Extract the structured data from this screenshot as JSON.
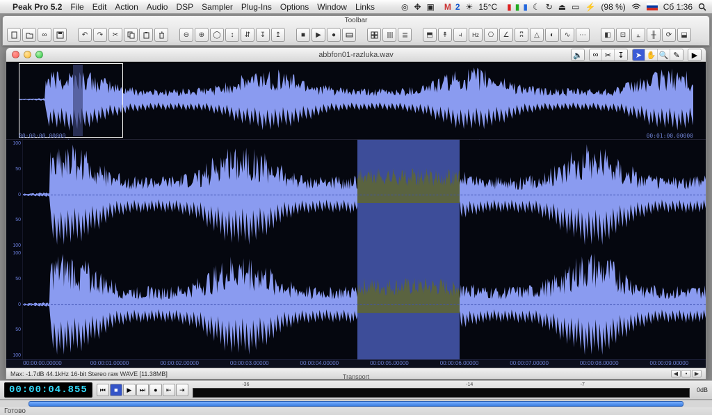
{
  "menubar": {
    "app": "Peak Pro 5.2",
    "items": [
      "File",
      "Edit",
      "Action",
      "Audio",
      "DSP",
      "Sampler",
      "Plug-Ins",
      "Options",
      "Window",
      "Links"
    ],
    "right": {
      "mail_label": "M",
      "mail_count": "2",
      "temp": "15°C",
      "battery": "(98 %)",
      "flag": "ru",
      "clock": "Сб 1:36"
    }
  },
  "toolbar": {
    "title": "Toolbar"
  },
  "document": {
    "title": "abbfon01-razluka.wav",
    "overview": {
      "start_tc": "00:00:00.00000",
      "end_tc": "00:01:00.00000"
    },
    "gutter": {
      "labels": [
        "100",
        "50",
        "0",
        "50",
        "100"
      ]
    },
    "ruler": {
      "marks": [
        "00:00:00.00000",
        "00:00:01.00000",
        "00:00:02.00000",
        "00:00:03.00000",
        "00:00:04.00000",
        "00:00:05.00000",
        "00:00:06.00000",
        "00:00:07.00000",
        "00:00:08.00000",
        "00:00:09.00000"
      ]
    },
    "status": "Max: -1.7dB   44.1kHz 16-bit Stereo raw  WAVE [11.38MB]"
  },
  "transport": {
    "title": "Transport",
    "timecode": "00:00:04.855",
    "vu_marks": [
      "-36",
      "-14",
      "-7"
    ],
    "readout": "0dB"
  },
  "bottom": {
    "status": "Готово"
  }
}
